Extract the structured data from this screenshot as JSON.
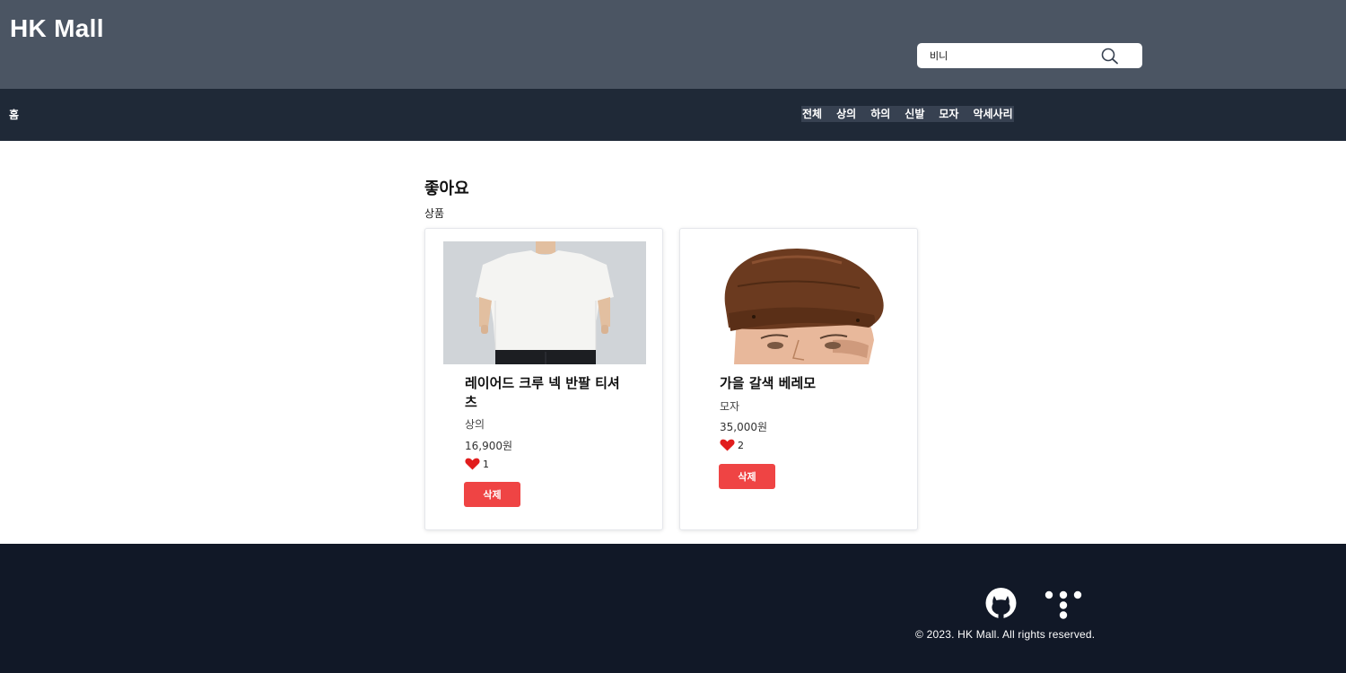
{
  "header": {
    "logo": "HK Mall",
    "search": {
      "value": "비니",
      "placeholder": ""
    }
  },
  "nav": {
    "home": "홈",
    "categories": [
      "전체",
      "상의",
      "하의",
      "신발",
      "모자",
      "악세사리"
    ]
  },
  "main": {
    "title": "좋아요",
    "section_label": "상품",
    "products": [
      {
        "name": "레이어드 크루 넥 반팔 티셔츠",
        "category": "상의",
        "price": "16,900원",
        "likes": "1",
        "delete_label": "삭제"
      },
      {
        "name": "가을 갈색 베레모",
        "category": "모자",
        "price": "35,000원",
        "likes": "2",
        "delete_label": "삭제"
      }
    ]
  },
  "footer": {
    "copyright": "© 2023. HK Mall. All rights reserved.",
    "icons": [
      "github-icon",
      "tistory-icon"
    ]
  },
  "colors": {
    "topbar": "#4b5563",
    "navbar": "#1f2937",
    "footer": "#111827",
    "delete_button": "#ef4444",
    "heart": "#e11d1d"
  }
}
